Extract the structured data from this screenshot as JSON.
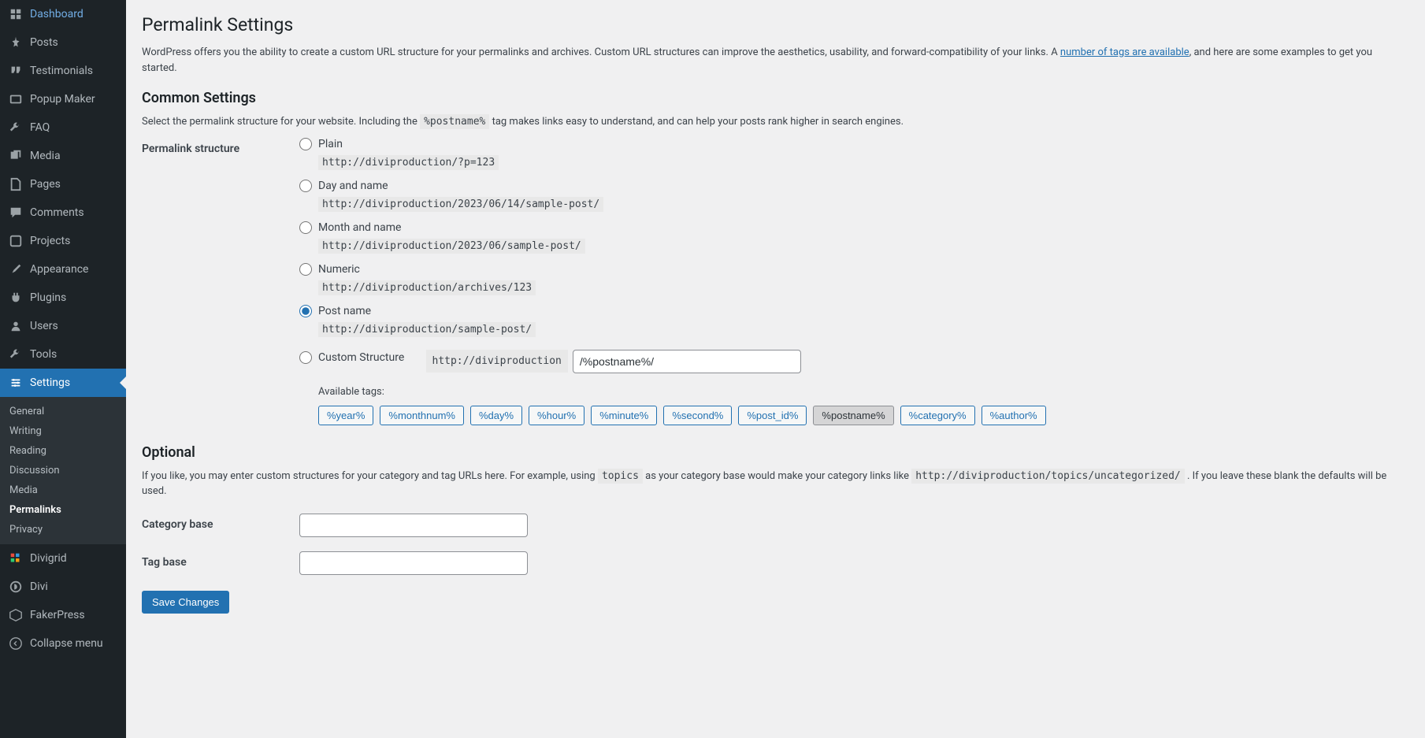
{
  "sidebar": {
    "items": [
      {
        "icon": "dashboard",
        "label": "Dashboard"
      },
      {
        "icon": "posts",
        "label": "Posts"
      },
      {
        "icon": "testimonials",
        "label": "Testimonials"
      },
      {
        "icon": "popup",
        "label": "Popup Maker"
      },
      {
        "icon": "faq",
        "label": "FAQ"
      },
      {
        "icon": "media",
        "label": "Media"
      },
      {
        "icon": "pages",
        "label": "Pages"
      },
      {
        "icon": "comments",
        "label": "Comments"
      },
      {
        "icon": "projects",
        "label": "Projects"
      },
      {
        "icon": "appearance",
        "label": "Appearance"
      },
      {
        "icon": "plugins",
        "label": "Plugins"
      },
      {
        "icon": "users",
        "label": "Users"
      },
      {
        "icon": "tools",
        "label": "Tools"
      },
      {
        "icon": "settings",
        "label": "Settings"
      },
      {
        "icon": "divigrid",
        "label": "Divigrid"
      },
      {
        "icon": "divi",
        "label": "Divi"
      },
      {
        "icon": "fakerpress",
        "label": "FakerPress"
      },
      {
        "icon": "collapse",
        "label": "Collapse menu"
      }
    ],
    "submenu": [
      {
        "label": "General"
      },
      {
        "label": "Writing"
      },
      {
        "label": "Reading"
      },
      {
        "label": "Discussion"
      },
      {
        "label": "Media"
      },
      {
        "label": "Permalinks",
        "current": true
      },
      {
        "label": "Privacy"
      }
    ]
  },
  "page": {
    "title": "Permalink Settings",
    "intro_prefix": "WordPress offers you the ability to create a custom URL structure for your permalinks and archives. Custom URL structures can improve the aesthetics, usability, and forward-compatibility of your links. A ",
    "intro_link": "number of tags are available",
    "intro_suffix": ", and here are some examples to get you started.",
    "common_heading": "Common Settings",
    "common_desc_prefix": "Select the permalink structure for your website. Including the ",
    "common_desc_code": "%postname%",
    "common_desc_suffix": " tag makes links easy to understand, and can help your posts rank higher in search engines.",
    "structure_label": "Permalink structure",
    "options": {
      "plain": {
        "label": "Plain",
        "example": "http://diviproduction/?p=123"
      },
      "day": {
        "label": "Day and name",
        "example": "http://diviproduction/2023/06/14/sample-post/"
      },
      "month": {
        "label": "Month and name",
        "example": "http://diviproduction/2023/06/sample-post/"
      },
      "numeric": {
        "label": "Numeric",
        "example": "http://diviproduction/archives/123"
      },
      "postname": {
        "label": "Post name",
        "example": "http://diviproduction/sample-post/"
      },
      "custom": {
        "label": "Custom Structure",
        "base": "http://diviproduction",
        "value": "/%postname%/"
      }
    },
    "available_tags_label": "Available tags:",
    "tags": [
      "%year%",
      "%monthnum%",
      "%day%",
      "%hour%",
      "%minute%",
      "%second%",
      "%post_id%",
      "%postname%",
      "%category%",
      "%author%"
    ],
    "optional_heading": "Optional",
    "optional_desc_prefix": "If you like, you may enter custom structures for your category and tag URLs here. For example, using ",
    "optional_desc_code1": "topics",
    "optional_desc_mid": " as your category base would make your category links like ",
    "optional_desc_code2": "http://diviproduction/topics/uncategorized/",
    "optional_desc_suffix": " . If you leave these blank the defaults will be used.",
    "category_base_label": "Category base",
    "category_base_value": "",
    "tag_base_label": "Tag base",
    "tag_base_value": "",
    "save_label": "Save Changes"
  }
}
